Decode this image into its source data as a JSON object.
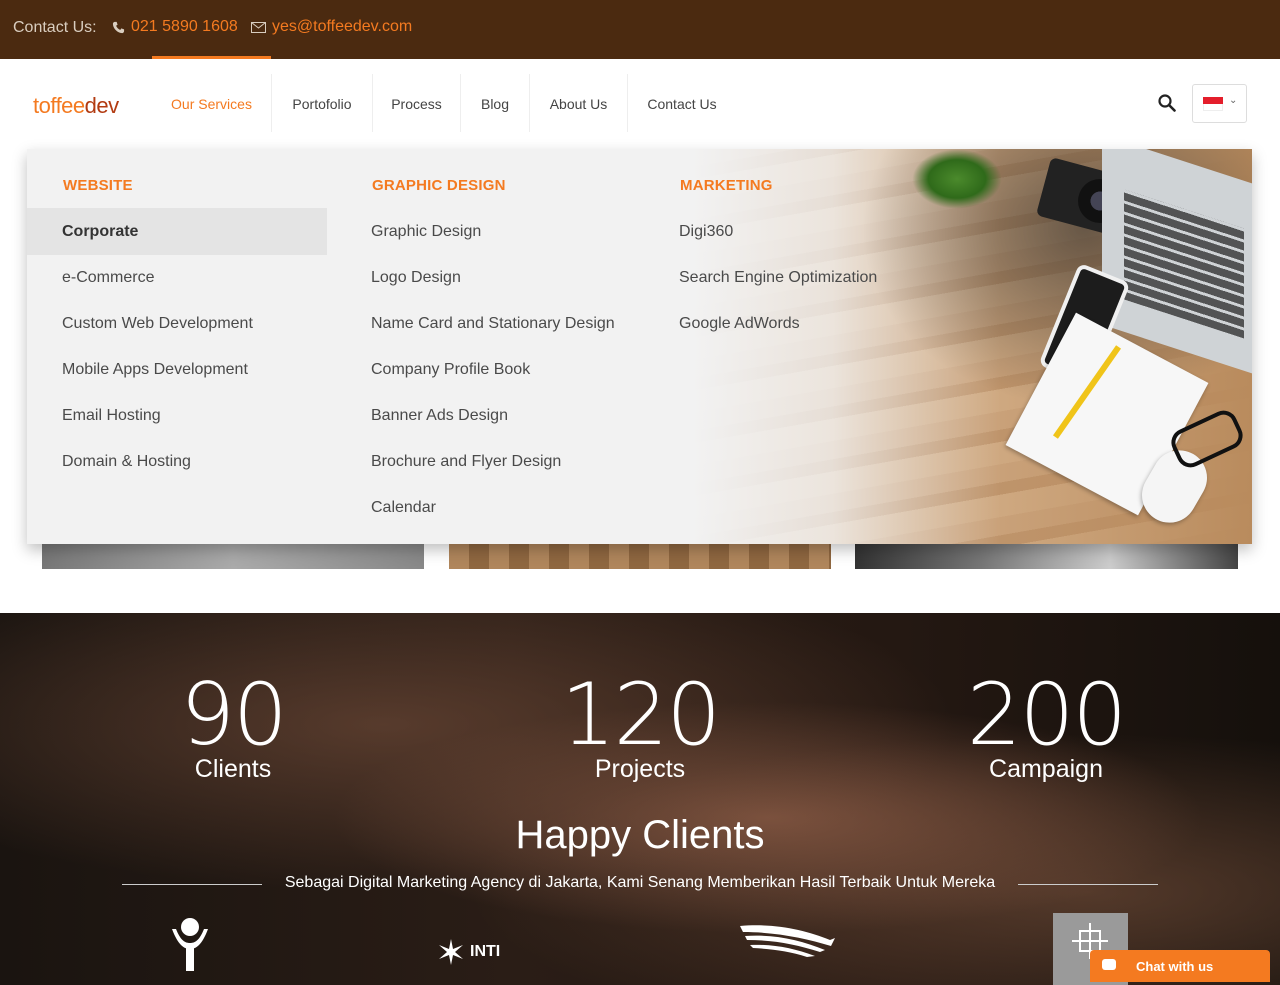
{
  "topbar": {
    "contact_label": "Contact Us:",
    "phone": "021 5890 1608",
    "email": "yes@toffeedev.com"
  },
  "logo": {
    "part1": "toffee",
    "part2": "dev"
  },
  "nav": {
    "items": [
      {
        "label": "Our Services",
        "active": true
      },
      {
        "label": "Portofolio"
      },
      {
        "label": "Process"
      },
      {
        "label": "Blog"
      },
      {
        "label": "About Us"
      },
      {
        "label": "Contact Us"
      }
    ]
  },
  "header": {
    "search_icon": "search-icon",
    "language": "Indonesia flag"
  },
  "mega_menu": {
    "columns": [
      {
        "title": "WEBSITE",
        "items": [
          "Corporate",
          "e-Commerce",
          "Custom Web Development",
          "Mobile Apps Development",
          "Email Hosting",
          "Domain & Hosting"
        ],
        "highlighted": "Corporate"
      },
      {
        "title": "GRAPHIC DESIGN",
        "items": [
          "Graphic Design",
          "Logo Design",
          "Name Card and Stationary Design",
          "Company Profile Book",
          "Banner Ads Design",
          "Brochure and Flyer Design",
          "Calendar"
        ]
      },
      {
        "title": "MARKETING",
        "items": [
          "Digi360",
          "Search Engine Optimization",
          "Google AdWords"
        ]
      }
    ]
  },
  "stats": [
    {
      "number": "90",
      "label": "Clients"
    },
    {
      "number": "120",
      "label": "Projects"
    },
    {
      "number": "200",
      "label": "Campaign"
    }
  ],
  "happy_clients": {
    "title": "Happy Clients",
    "subtitle": "Sebagai Digital Marketing Agency di Jakarta, Kami Senang Memberikan Hasil Terbaik Untuk Mereka",
    "logos": [
      "imamatek",
      "INTI International University & Colleges",
      "Garuda Indonesia",
      "MARC"
    ]
  },
  "chat": {
    "label": "Chat with us"
  },
  "colors": {
    "accent": "#f47a20",
    "topbar": "#4b2a10"
  }
}
